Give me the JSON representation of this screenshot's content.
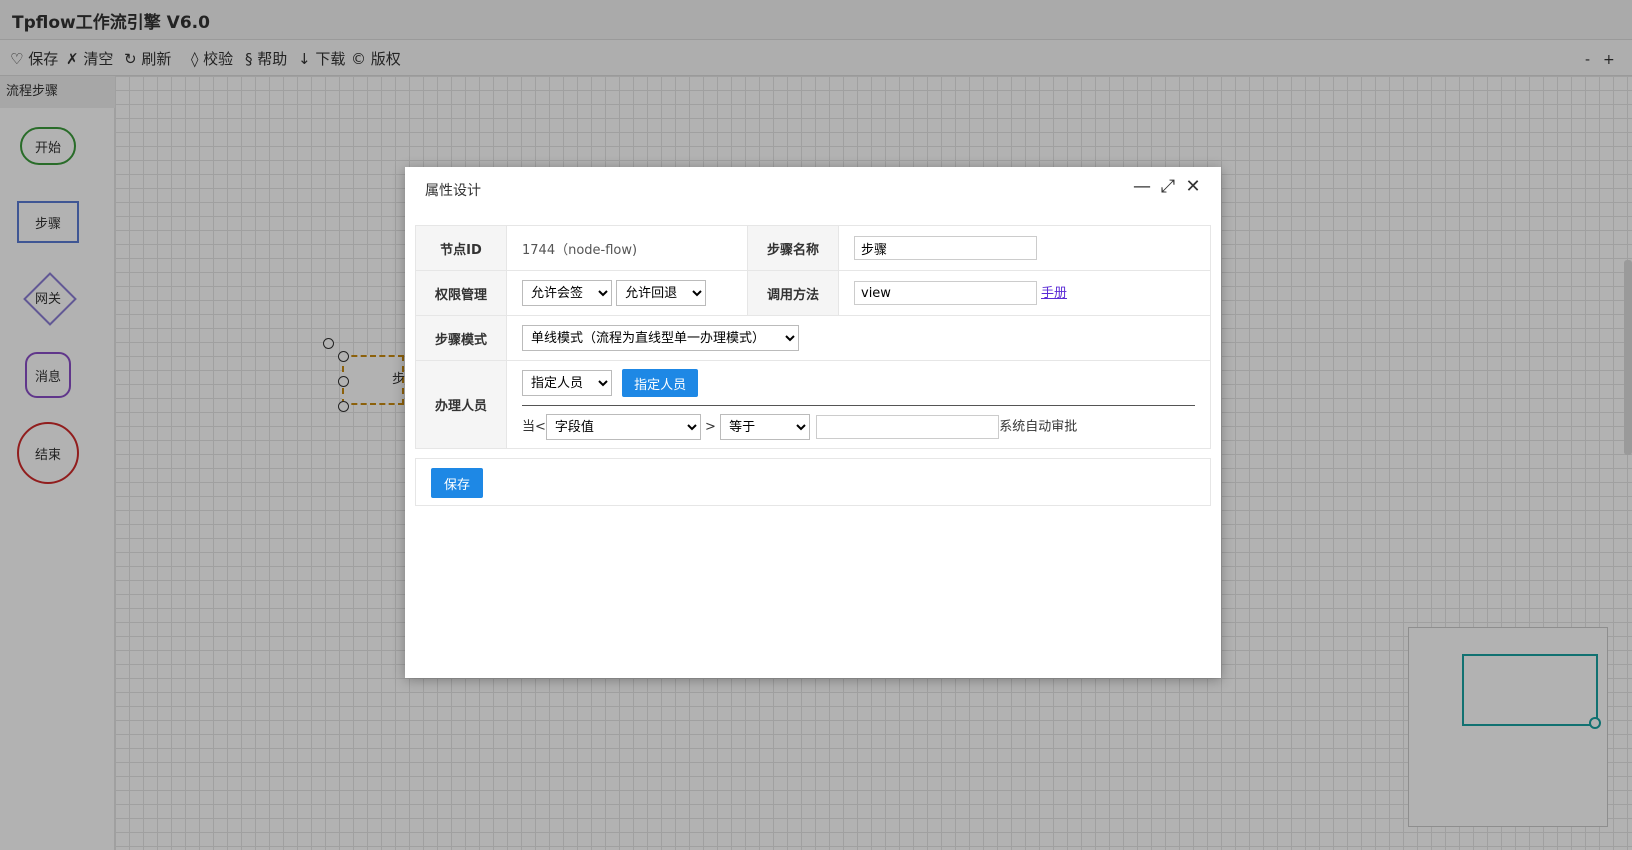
{
  "app": {
    "title": "Tpflow工作流引擎 V6.0"
  },
  "toolbar": {
    "items": [
      {
        "icon": "heart-icon",
        "label": "♡ 保存"
      },
      {
        "icon": "clear-icon",
        "label": "✗ 清空"
      },
      {
        "icon": "refresh-icon",
        "label": "↻ 刷新"
      },
      {
        "icon": "check-icon",
        "label": "◊ 校验"
      },
      {
        "icon": "help-icon",
        "label": "§ 帮助"
      },
      {
        "icon": "download-icon",
        "label": "↓ 下载"
      },
      {
        "icon": "copyright-icon",
        "label": "© 版权"
      }
    ],
    "zoom_out": "-",
    "zoom_in": "+"
  },
  "panel": {
    "title": "流程步骤",
    "shapes": [
      {
        "label": "开始",
        "color": "#3b9b3b"
      },
      {
        "label": "步骤",
        "color": "#5b7bd5"
      },
      {
        "label": "网关",
        "color": "#8d7fd6"
      },
      {
        "label": "消息",
        "color": "#8a4ec7"
      },
      {
        "label": "结束",
        "color": "#d02a2a"
      }
    ]
  },
  "canvas": {
    "node_label": "步"
  },
  "modal": {
    "title": "属性设计",
    "minimize": "—",
    "maximize": "⤢",
    "close": "✕",
    "labels": {
      "node_id": "节点ID",
      "step_name": "步骤名称",
      "permission": "权限管理",
      "call_method": "调用方法",
      "step_mode": "步骤模式",
      "actor": "办理人员"
    },
    "node_id_value": "1744（node-flow)",
    "step_name_value": "步骤",
    "call_method_value": "view",
    "manual_link": "手册",
    "permission_sign": "允许会签",
    "permission_back": "允许回退",
    "step_mode_value": "单线模式（流程为直线型单一办理模式）",
    "actor_select": "指定人员",
    "actor_button": "指定人员",
    "cond_prefix": "当<",
    "cond_field": "字段值",
    "cond_gt": ">",
    "cond_op": "等于",
    "cond_value": "",
    "cond_suffix": "系统自动审批",
    "save_button": "保存"
  },
  "colors": {
    "accent": "#1e88e5",
    "link": "#5b2bd6",
    "minimap": "#19a3a3"
  }
}
